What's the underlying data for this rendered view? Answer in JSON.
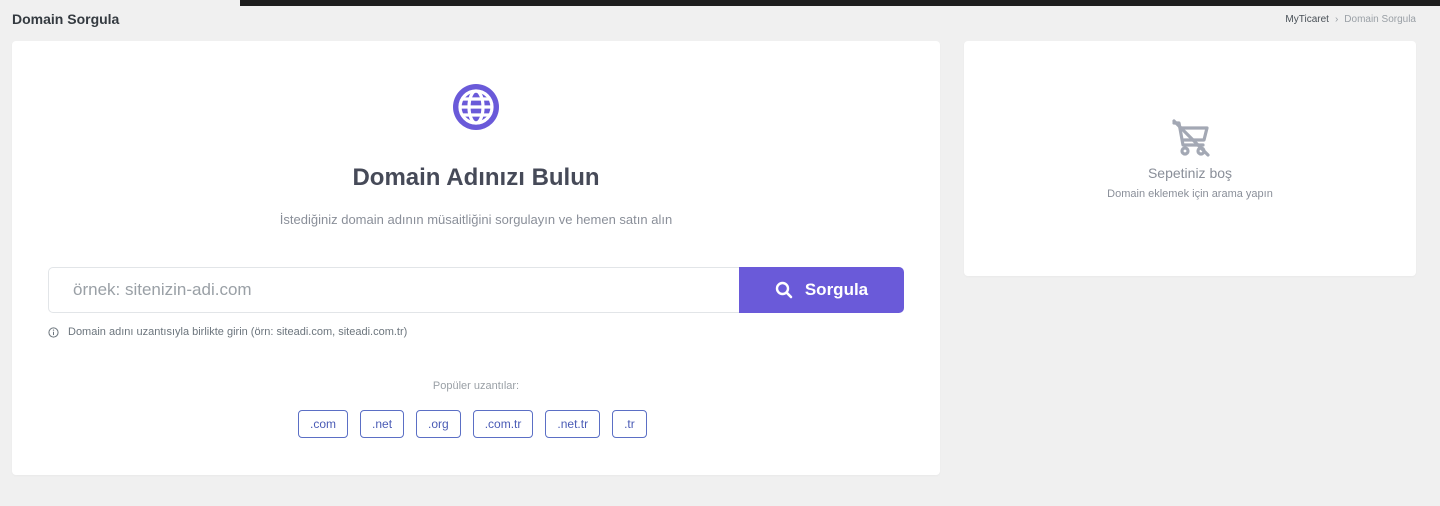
{
  "header": {
    "title": "Domain Sorgula",
    "breadcrumb": {
      "root": "MyTicaret",
      "separator": "›",
      "current": "Domain Sorgula"
    }
  },
  "search": {
    "icon": "globe-icon",
    "title": "Domain Adınızı Bulun",
    "subtitle": "İstediğiniz domain adının müsaitliğini sorgulayın ve hemen satın alın",
    "placeholder": "örnek: sitenizin-adi.com",
    "button_label": "Sorgula",
    "hint": "Domain adını uzantısıyla birlikte girin (örn: siteadi.com, siteadi.com.tr)",
    "popular_label": "Popüler uzantılar:",
    "extensions": [
      ".com",
      ".net",
      ".org",
      ".com.tr",
      ".net.tr",
      ".tr"
    ]
  },
  "cart": {
    "icon": "cart-off-icon",
    "empty_title": "Sepetiniz boş",
    "empty_subtitle": "Domain eklemek için arama yapın"
  },
  "colors": {
    "accent": "#6a5ad9",
    "extension_border": "#5b6fc5",
    "background": "#f0f0f0"
  }
}
